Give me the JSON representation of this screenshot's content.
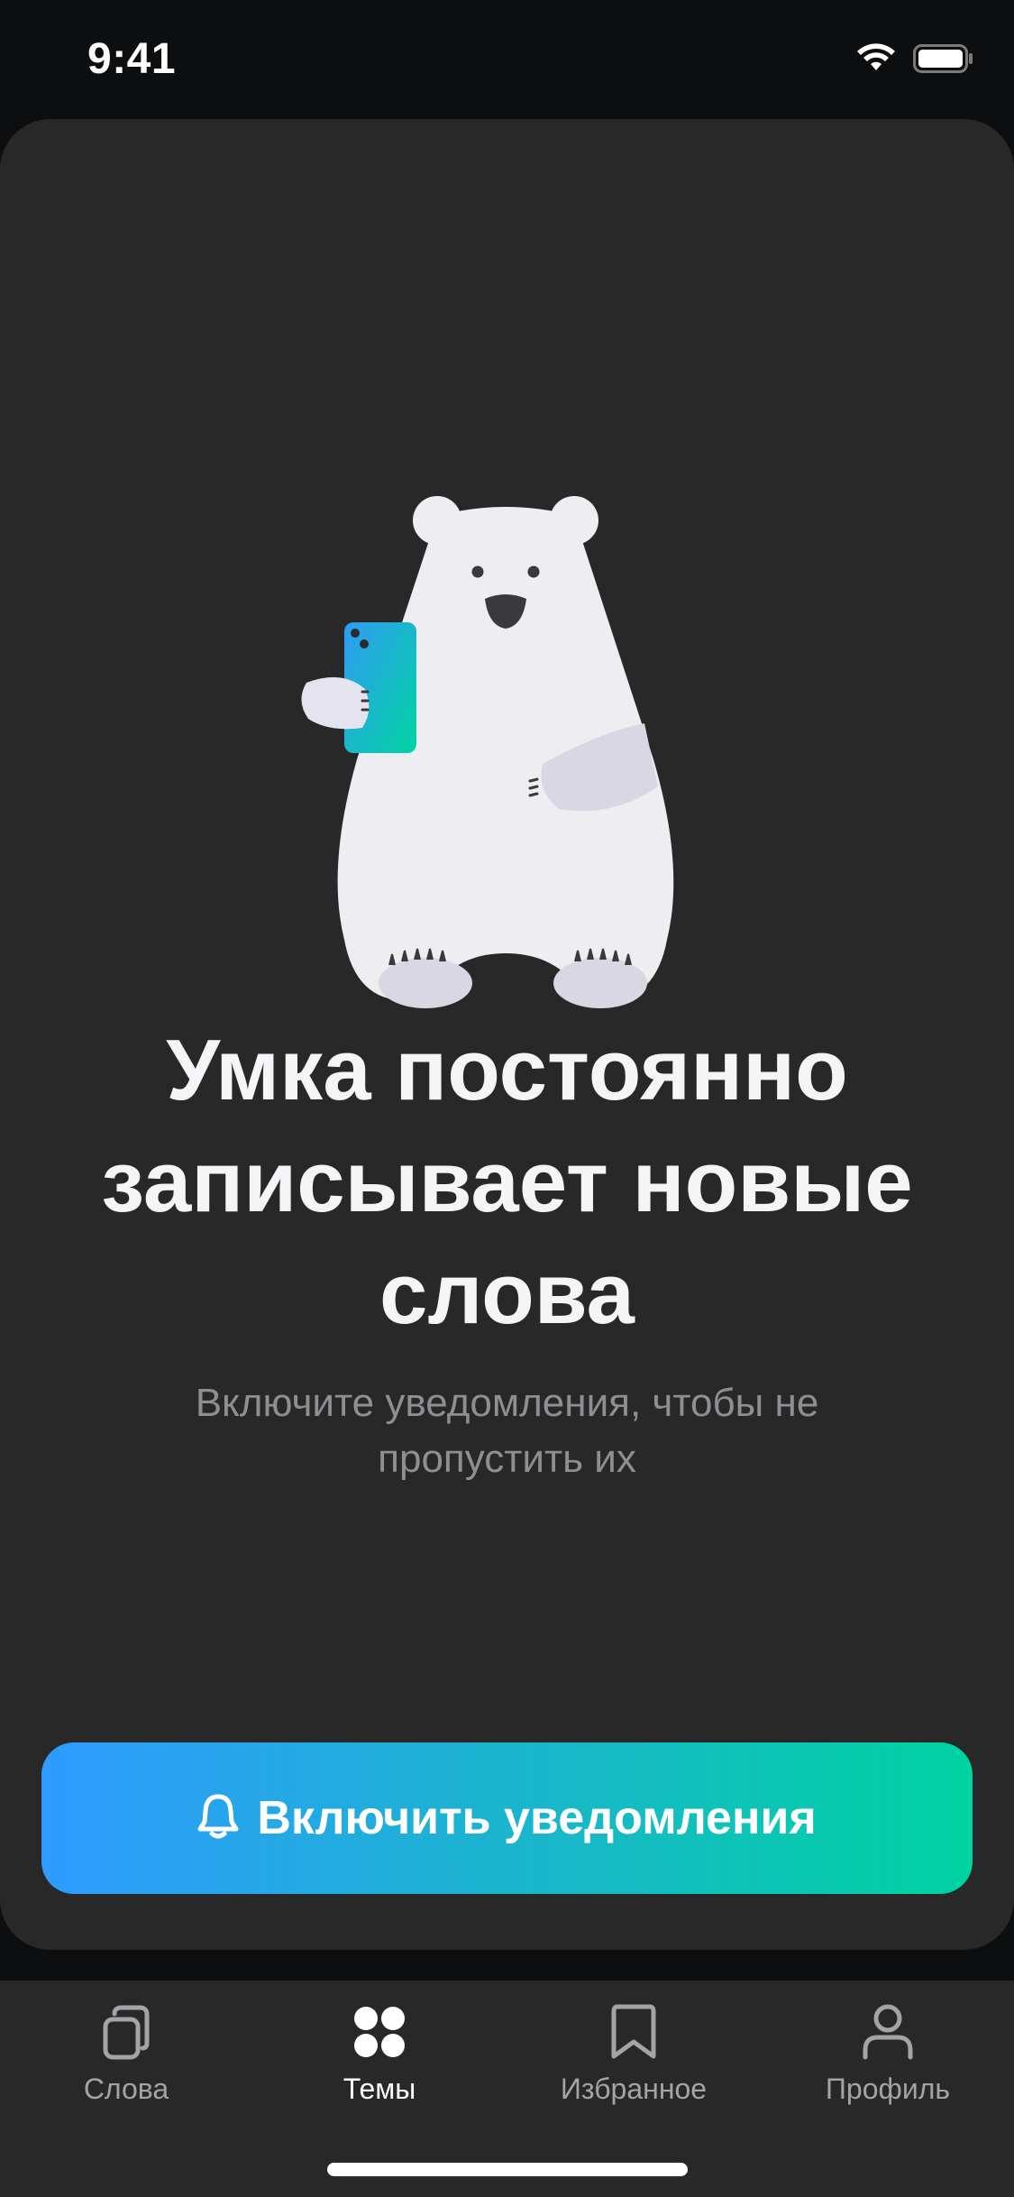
{
  "status_bar": {
    "time": "9:41",
    "icons": [
      "wifi-icon",
      "battery-icon"
    ]
  },
  "onboarding": {
    "illustration": "polar-bear-with-phone",
    "headline": "Умка постоянно записывает новые слова",
    "subtitle": "Включите уведомления, чтобы не пропустить их",
    "cta": {
      "label": "Включить уведомления",
      "icon": "bell-icon",
      "gradient": [
        "#2f9bff",
        "#00d3a2"
      ]
    }
  },
  "tabbar": {
    "active": "Темы",
    "items": [
      {
        "label": "Слова",
        "icon": "cards-icon"
      },
      {
        "label": "Темы",
        "icon": "grid-dots-icon"
      },
      {
        "label": "Избранное",
        "icon": "bookmark-icon"
      },
      {
        "label": "Профиль",
        "icon": "person-icon"
      }
    ]
  },
  "colors": {
    "background": "#0d0e10",
    "card": "#282828",
    "headline": "#f5f5f7",
    "subtitle": "#8e8e93",
    "tab_inactive": "#a3a3a8",
    "tab_active": "#ffffff"
  }
}
